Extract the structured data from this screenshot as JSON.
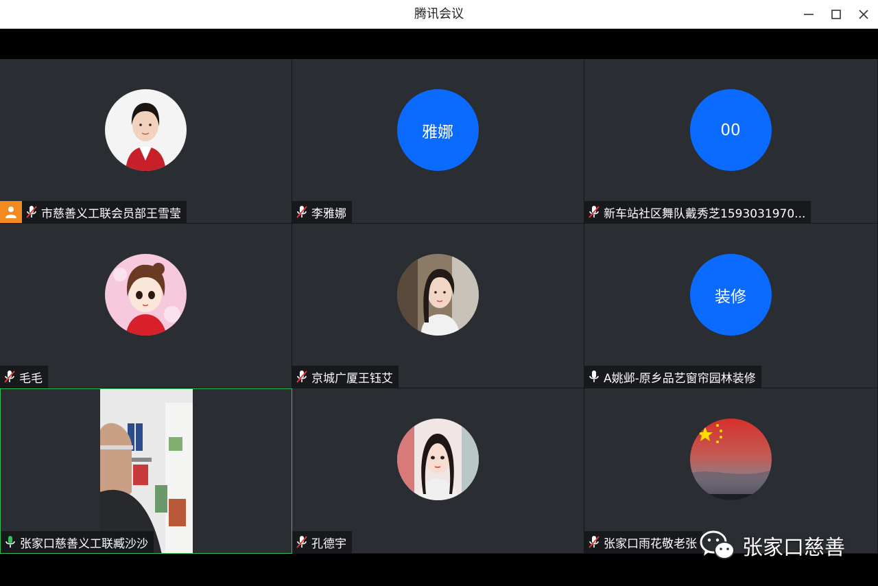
{
  "window": {
    "title": "腾讯会议"
  },
  "colors": {
    "tile_bg": "#2a2d31",
    "avatar_blue": "#0b6bff",
    "host_orange": "#f28a1f",
    "speaking_green": "#2fbf5b"
  },
  "participants": [
    {
      "name": "市慈善义工联会员部王雪莹",
      "avatar": "photo",
      "mic": "muted",
      "host": true
    },
    {
      "name": "李雅娜",
      "avatar_text": "雅娜",
      "mic": "muted"
    },
    {
      "name": "新车站社区舞队戴秀芝1593031970...",
      "avatar_text": "00",
      "mic": "muted"
    },
    {
      "name": "毛毛",
      "avatar": "cartoon",
      "mic": "muted"
    },
    {
      "name": "京城广厦王钰艾",
      "avatar": "photo",
      "mic": "muted"
    },
    {
      "name": "A姚邺-原乡品艺窗帘园林装修",
      "avatar_text": "装修",
      "mic": "on"
    },
    {
      "name": "张家口慈善义工联臧沙沙",
      "avatar": "video",
      "mic": "speaking"
    },
    {
      "name": "孔德宇",
      "avatar": "photo",
      "mic": "muted"
    },
    {
      "name": "张家口雨花敬老张",
      "avatar": "flag-photo",
      "mic": "muted"
    }
  ],
  "watermark": {
    "text": "张家口慈善",
    "icon": "wechat-icon"
  }
}
